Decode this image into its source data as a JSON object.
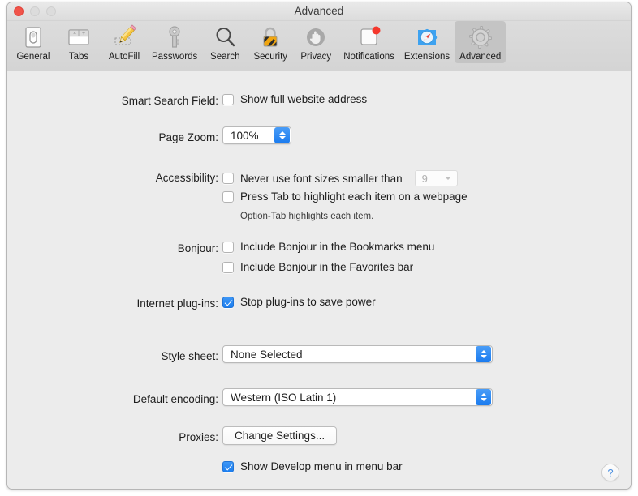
{
  "window": {
    "title": "Advanced",
    "traffic_lights": [
      "close",
      "minimize",
      "zoom"
    ],
    "accent_blue": "#1a7bef",
    "background": "#ececec"
  },
  "toolbar": {
    "items": [
      {
        "label": "General",
        "icon": "general-icon",
        "selected": false
      },
      {
        "label": "Tabs",
        "icon": "tabs-icon",
        "selected": false
      },
      {
        "label": "AutoFill",
        "icon": "autofill-icon",
        "selected": false
      },
      {
        "label": "Passwords",
        "icon": "key-icon",
        "selected": false
      },
      {
        "label": "Search",
        "icon": "magnifier-icon",
        "selected": false
      },
      {
        "label": "Security",
        "icon": "lock-icon",
        "selected": false
      },
      {
        "label": "Privacy",
        "icon": "hand-icon",
        "selected": false
      },
      {
        "label": "Notifications",
        "icon": "notifications-icon",
        "selected": false
      },
      {
        "label": "Extensions",
        "icon": "puzzle-compass-icon",
        "selected": false
      },
      {
        "label": "Advanced",
        "icon": "gear-icon",
        "selected": true
      }
    ]
  },
  "form": {
    "smart_search": {
      "label": "Smart Search Field:",
      "checkbox_label": "Show full website address",
      "checked": false
    },
    "page_zoom": {
      "label": "Page Zoom:",
      "value": "100%"
    },
    "accessibility": {
      "label": "Accessibility:",
      "font_size_checkbox_label": "Never use font sizes smaller than",
      "font_size_checked": false,
      "font_size_value": "9",
      "font_size_enabled": false,
      "tab_highlight_label": "Press Tab to highlight each item on a webpage",
      "tab_highlight_checked": false,
      "hint": "Option-Tab highlights each item."
    },
    "bonjour": {
      "label": "Bonjour:",
      "bookmarks_label": "Include Bonjour in the Bookmarks menu",
      "bookmarks_checked": false,
      "favorites_label": "Include Bonjour in the Favorites bar",
      "favorites_checked": false
    },
    "internet_plugins": {
      "label": "Internet plug-ins:",
      "checkbox_label": "Stop plug-ins to save power",
      "checked": true
    },
    "style_sheet": {
      "label": "Style sheet:",
      "value": "None Selected"
    },
    "default_encoding": {
      "label": "Default encoding:",
      "value": "Western (ISO Latin 1)"
    },
    "proxies": {
      "label": "Proxies:",
      "button_label": "Change Settings..."
    },
    "develop_menu": {
      "checkbox_label": "Show Develop menu in menu bar",
      "checked": true
    }
  },
  "help_button": {
    "glyph": "?",
    "name": "help-button"
  }
}
